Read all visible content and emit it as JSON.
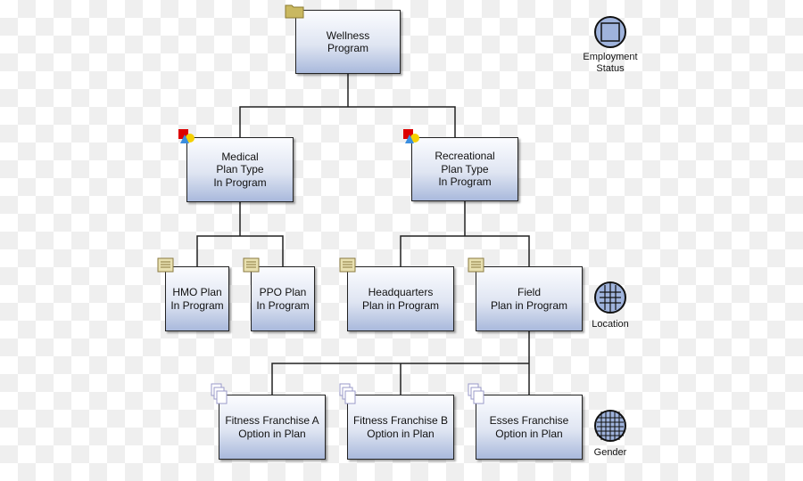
{
  "nodes": {
    "wellness": "Wellness\nProgram",
    "medical": "Medical\nPlan Type\nIn Program",
    "recreational": "Recreational\nPlan Type\nIn Program",
    "hmo": "HMO Plan\nIn Program",
    "ppo": "PPO Plan\nIn Program",
    "headquarters": "Headquarters\nPlan in Program",
    "field": "Field\nPlan in Program",
    "fitness_a": "Fitness Franchise A\nOption in Plan",
    "fitness_b": "Fitness Franchise B\nOption in Plan",
    "esses": "Esses Franchise\nOption in Plan"
  },
  "legend": {
    "employment_status": "Employment\nStatus",
    "location": "Location",
    "gender": "Gender"
  },
  "icons": {
    "program": "folder-icon",
    "plan_type": "shapes-icon",
    "plan": "scroll-icon",
    "option": "documents-icon"
  }
}
